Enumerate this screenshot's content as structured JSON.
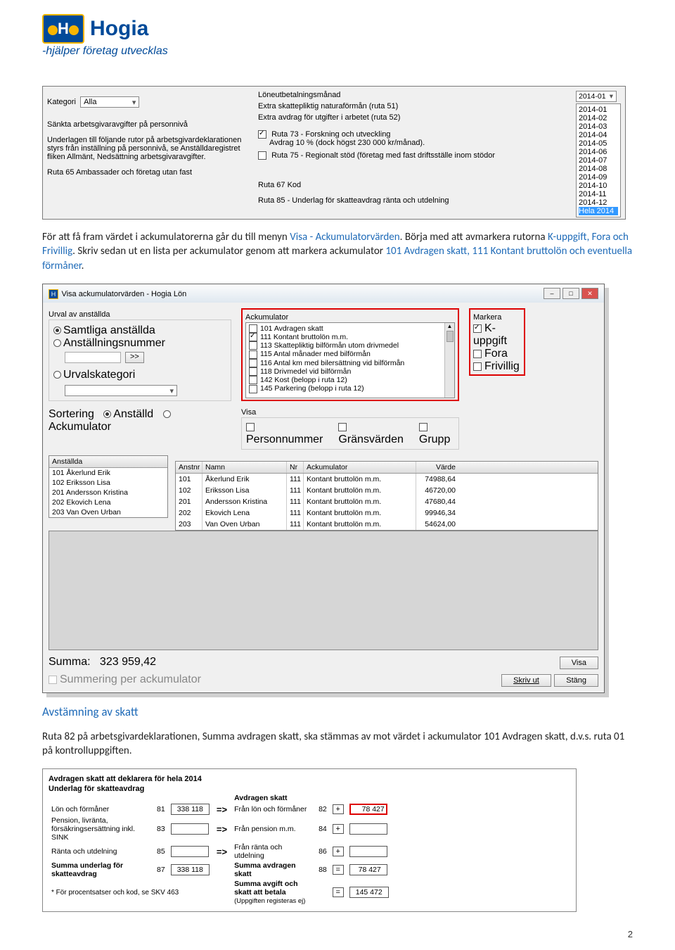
{
  "logo": {
    "brand": "Hogia",
    "tagline": "-hjälper företag utvecklas"
  },
  "ss1": {
    "kategori_label": "Kategori",
    "kategori_value": "Alla",
    "heading1": "Sänkta arbetsgivaravgifter på personnivå",
    "underlag": "Underlagen till följande rutor på arbetsgivardeklarationen styrs från inställning på personnivå, se Anställdaregistret fliken Allmänt, Nedsättning arbetsgivaravgifter.",
    "ruta65": "Ruta 65 Ambassader och företag utan fast",
    "r1": "Löneutbetalningsmånad",
    "r2": "Extra skattepliktig naturaförmån (ruta 51)",
    "r3": "Extra avdrag för utgifter i arbetet (ruta 52)",
    "cb73": "Ruta 73 - Forskning och utveckling",
    "cb73b": "Avdrag 10 % (dock högst 230 000 kr/månad).",
    "cb75": "Ruta 75 - Regionalt stöd (företag med fast driftsställe inom stödor",
    "r67": "Ruta 67 Kod",
    "r85": "Ruta 85 - Underlag för skatteavdrag ränta och utdelning",
    "period_sel": "2014-01",
    "periods": [
      "2014-01",
      "2014-02",
      "2014-03",
      "2014-04",
      "2014-05",
      "2014-06",
      "2014-07",
      "2014-08",
      "2014-09",
      "2014-10",
      "2014-11",
      "2014-12"
    ],
    "period_hela": "Hela 2014"
  },
  "para1_a": "För att få fram värdet i ackumulatorerna går du till menyn ",
  "para1_b": "Visa - Ackumulatorvärden",
  "para1_c": ". Börja med att avmarkera rutorna ",
  "para1_d": "K-uppgift, Fora och Frivillig",
  "para1_e": ". Skriv sedan ut en lista per ackumulator genom att markera ackumulator ",
  "para1_f": "101 Avdragen skatt, 111 Kontant bruttolön och eventuella förmåner",
  "para1_g": ".",
  "dlg": {
    "title": "Visa ackumulatorvärden - Hogia Lön",
    "urvallbl": "Urval av anställda",
    "opt_samtliga": "Samtliga anställda",
    "opt_anstnr": "Anställningsnummer",
    "opt_urval": "Urvalskategori",
    "sort_lbl": "Sortering",
    "sort_anst": "Anställd",
    "sort_ack": "Ackumulator",
    "ack_lbl": "Ackumulator",
    "ack_items": [
      {
        "chk": false,
        "t": "101 Avdragen skatt"
      },
      {
        "chk": true,
        "t": "111 Kontant bruttolön m.m."
      },
      {
        "chk": false,
        "t": "113 Skattepliktig bilförmån utom drivmedel"
      },
      {
        "chk": false,
        "t": "115 Antal månader med bilförmån"
      },
      {
        "chk": false,
        "t": "116 Antal km med bilersättning vid bilförmån"
      },
      {
        "chk": false,
        "t": "118 Drivmedel vid bilförmån"
      },
      {
        "chk": false,
        "t": "142 Kost (belopp i ruta 12)"
      },
      {
        "chk": false,
        "t": "145 Parkering (belopp i ruta 12)"
      }
    ],
    "markera_lbl": "Markera",
    "m_k": "K-uppgift",
    "m_f": "Fora",
    "m_fr": "Frivillig",
    "visa_lbl": "Visa",
    "v_pn": "Personnummer",
    "v_gr": "Gränsvärden",
    "v_gp": "Grupp",
    "left_hd": "Anställda",
    "left_items": [
      "101 Åkerlund Erik",
      "102 Eriksson Lisa",
      "201 Andersson Kristina",
      "202 Ekovich Lena",
      "203 Van Oven Urban"
    ],
    "g_h1": "Anstnr",
    "g_h2": "Namn",
    "g_h3": "Nr",
    "g_h4": "Ackumulator",
    "g_h5": "Värde",
    "rows": [
      {
        "a": "101",
        "n": "Åkerlund Erik",
        "nr": "111",
        "ack": "Kontant bruttolön m.m.",
        "v": "74988,64"
      },
      {
        "a": "102",
        "n": "Eriksson Lisa",
        "nr": "111",
        "ack": "Kontant bruttolön m.m.",
        "v": "46720,00"
      },
      {
        "a": "201",
        "n": "Andersson Kristina",
        "nr": "111",
        "ack": "Kontant bruttolön m.m.",
        "v": "47680,44"
      },
      {
        "a": "202",
        "n": "Ekovich Lena",
        "nr": "111",
        "ack": "Kontant bruttolön m.m.",
        "v": "99946,34"
      },
      {
        "a": "203",
        "n": "Van Oven Urban",
        "nr": "111",
        "ack": "Kontant bruttolön m.m.",
        "v": "54624,00"
      }
    ],
    "summa_lbl": "Summa:",
    "summa_val": "323 959,42",
    "chk_summ": "Summering per ackumulator",
    "btn_visa": "Visa",
    "btn_skriv": "Skriv ut",
    "btn_stang": "Stäng",
    "fwd_btn": ">>"
  },
  "h3": "Avstämning av skatt",
  "para2": "Ruta 82 på arbetsgivardeklarationen, Summa avdragen skatt, ska stämmas av mot värdet i ackumulator 101 Avdragen skatt, d.v.s. ruta 01 på kontrolluppgiften.",
  "ss3": {
    "t1": "Avdragen skatt att deklarera för hela 2014",
    "t2": "Underlag för skatteavdrag",
    "col_r": "Avdragen skatt",
    "r81l": "Lön och förmåner",
    "r81n": "81",
    "r81v": "338 118",
    "r83l": "Pension, livränta, försäkringsersättning inkl. SINK",
    "r83n": "83",
    "r85l": "Ränta och utdelning",
    "r85n": "85",
    "r87l": "Summa underlag för skatteavdrag",
    "r87n": "87",
    "r87v": "338 118",
    "note": "* För procentsatser och kod, se SKV 463",
    "r82l": "Från lön och förmåner",
    "r82n": "82",
    "r82v": "78 427",
    "r84l": "Från pension m.m.",
    "r84n": "84",
    "r86l": "Från ränta och utdelning",
    "r86n": "86",
    "r88l": "Summa avdragen skatt",
    "r88n": "88",
    "r88v": "78 427",
    "rfinl": "Summa avgift och skatt att betala",
    "rfin_note": "(Uppgiften registeras ej)",
    "rfinv": "145 472",
    "plus": "+",
    "eq": "=",
    "arrow": "=>"
  },
  "pagenum": "2"
}
